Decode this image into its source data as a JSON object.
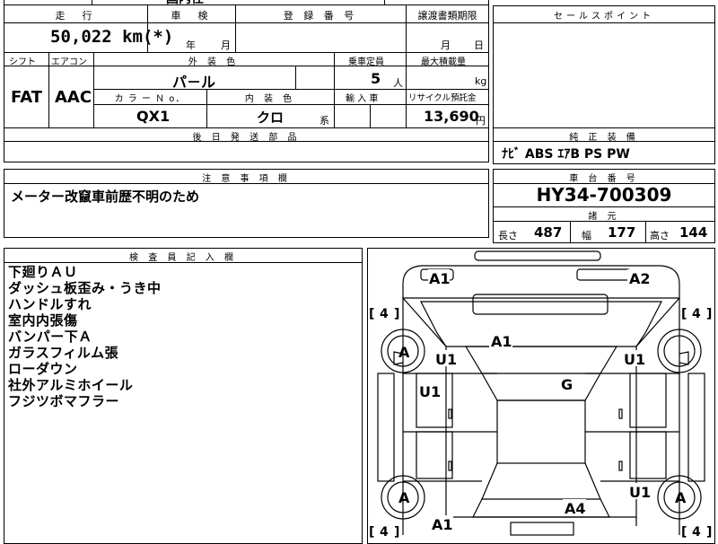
{
  "top_partial": {
    "text": "国内仕"
  },
  "main": {
    "mileage_label": "走　行",
    "mileage_value": "50,022 km(*)",
    "inspection_label": "車　検",
    "year_unit": "年",
    "month_unit": "月",
    "registration_label": "登 録 番 号",
    "transfer_label": "譲渡書類期限",
    "transfer_month": "月",
    "transfer_day": "日",
    "shift_label": "シフト",
    "shift_value": "FAT",
    "ac_label": "エアコン",
    "ac_value": "AAC",
    "exterior_label": "外 装 色",
    "exterior_value": "パ－ル",
    "capacity_label": "乗車定員",
    "capacity_value": "5",
    "capacity_unit": "人",
    "load_label": "最大積載量",
    "load_unit": "kg",
    "color_no_label": "カ ラ ー Ｎ o．",
    "color_no_value": "QX1",
    "interior_label": "内 装 色",
    "interior_value": "クロ",
    "interior_unit": "系",
    "import_label": "輸 入 車",
    "recycle_label": "リサイクル預託金",
    "recycle_value": "13,690",
    "recycle_unit": "円",
    "shipping_label": "後 日 発 送 部 品"
  },
  "sales_point": {
    "label": "セールスポイント"
  },
  "equipment": {
    "label": "純 正 装 備",
    "value": "ﾅﾋﾞ  ABS  ｴｱB  PS  PW"
  },
  "notes": {
    "label": "注 意 事 項 欄",
    "value": "メーター改竄車前歴不明のため"
  },
  "chassis": {
    "label": "車 台 番 号",
    "value": "HY34-700309"
  },
  "specs": {
    "label": "諸 元",
    "length_label": "長さ",
    "length_value": "487",
    "width_label": "幅",
    "width_value": "177",
    "height_label": "高さ",
    "height_value": "144"
  },
  "inspector": {
    "label": "検 査 員 記 入 欄",
    "items": [
      "下廻りＡＵ",
      "ダッシュ板歪み・うき中",
      "ハンドルすれ",
      "室内内張傷",
      "バンパー下Ａ",
      "ガラスフィルム張",
      "ローダウン",
      "社外アルミホイール",
      "フジツボマフラー"
    ]
  },
  "diagram": {
    "marks": {
      "front_left": "A1",
      "front_right": "A2",
      "hood": "A1",
      "left_fender": "U1",
      "right_fender": "U1",
      "left_front_door": "U1",
      "roof": "G",
      "right_rear": "U1",
      "trunk": "A4",
      "rear_left": "A1",
      "wheel_fl": "A",
      "wheel_rl": "A",
      "wheel_rr": "A",
      "tire_fl": "4",
      "tire_fr": "4",
      "tire_rl": "4",
      "tire_rr": "4"
    }
  }
}
